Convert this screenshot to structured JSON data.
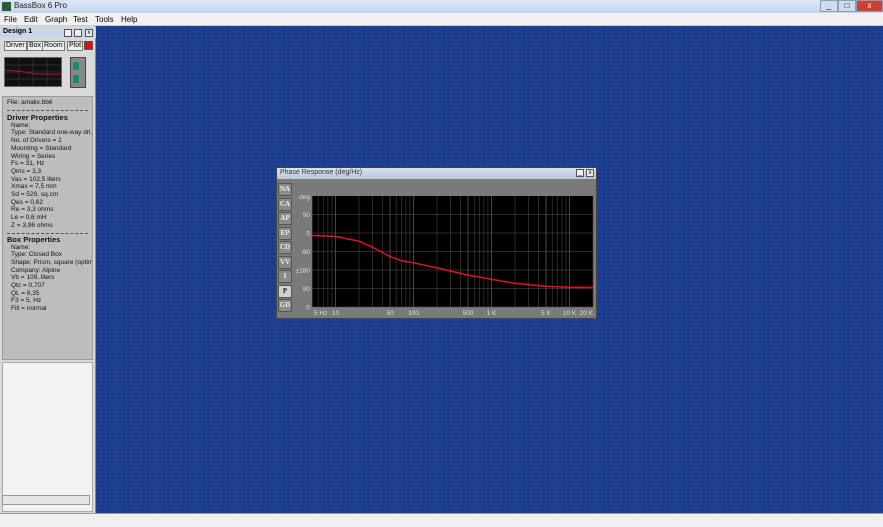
{
  "app": {
    "title": "BassBox 6 Pro",
    "controls": [
      "_",
      "□",
      "x"
    ]
  },
  "menu": [
    "File",
    "Edit",
    "Graph",
    "Test",
    "Tools",
    "Help"
  ],
  "design": {
    "title": "Design 1",
    "tabs": [
      "Driver",
      "Box",
      "Room",
      "Plot"
    ],
    "record_color": "#e01010"
  },
  "info": {
    "file": "File: amalix.bb6",
    "driver_heading": "Driver Properties",
    "driver": [
      "Name:",
      "Type: Standard one-way dri.",
      "No. of Drivers = 2",
      "Mounting = Standard",
      "Wiring = Series",
      "Fs = 31, Hz",
      "Qms = 3,3",
      "Vas = 102,5 liters",
      "Xmax = 7,5 mm",
      "Sd = 529, sq.cm",
      "Qes = 0,62",
      "Re = 3,3 ohms",
      "Le = 0,6 mH",
      "Z = 3,96 ohms"
    ],
    "box_heading": "Box Properties",
    "box": [
      "Name:",
      "Type: Closed Box",
      "Shape: Prism, square (optim.",
      "Company: Alpine",
      "Vb = 109, liters",
      "Qtc = 0,707",
      "QL = 6,35",
      "F3 = 5, Hz",
      "Fill = normal"
    ]
  },
  "phase_window": {
    "title": "Phase Response (deg/Hz)",
    "buttons": [
      "NA",
      "CA",
      "AP",
      "EP",
      "CD",
      "VV",
      "I",
      "P",
      "GD"
    ],
    "active_button": "P"
  },
  "chart_data": {
    "type": "line",
    "ylabel": "deg",
    "x_scale": "log",
    "xlim": [
      5,
      20000
    ],
    "xticks": [
      {
        "v": 5,
        "label": "5 Hz"
      },
      {
        "v": 10,
        "label": "10"
      },
      {
        "v": 50,
        "label": "50"
      },
      {
        "v": 100,
        "label": "100"
      },
      {
        "v": 500,
        "label": "500"
      },
      {
        "v": 1000,
        "label": "1 K"
      },
      {
        "v": 5000,
        "label": "5 K"
      },
      {
        "v": 10000,
        "label": "10 K"
      },
      {
        "v": 20000,
        "label": "20 K"
      }
    ],
    "ytick_labels": [
      "90",
      "0",
      "-90",
      "±180",
      "90",
      "0",
      "-90",
      "±180"
    ],
    "ylim": [
      -180,
      360
    ],
    "grid": true,
    "line_color": "#e0102a",
    "x": [
      5,
      10,
      20,
      30,
      50,
      70,
      100,
      200,
      500,
      1000,
      2000,
      5000,
      10000,
      20000
    ],
    "y": [
      168,
      163,
      140,
      110,
      65,
      45,
      35,
      10,
      -25,
      -45,
      -65,
      -80,
      -84,
      -85
    ]
  }
}
